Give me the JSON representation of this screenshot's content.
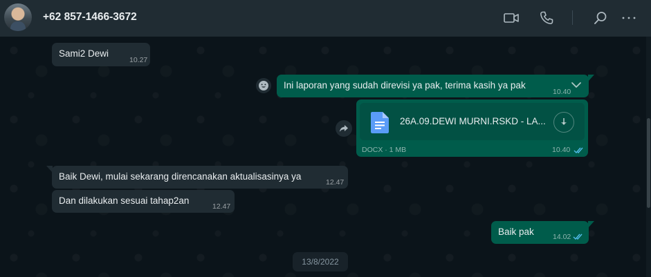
{
  "header": {
    "contact_name": "+62 857-1466-3672",
    "icons": [
      "video-call-icon",
      "voice-call-icon",
      "search-icon",
      "menu-icon"
    ]
  },
  "messages": [
    {
      "direction": "incoming",
      "text": "Sami2 Dewi",
      "time": "10.27"
    },
    {
      "direction": "outgoing",
      "text": "Ini laporan yang sudah direvisi ya pak, terima kasih ya pak",
      "time": "10.40"
    },
    {
      "direction": "outgoing",
      "type": "document",
      "filename": "26A.09.DEWI MURNI.RSKD - LA...",
      "file_type": "DOCX",
      "file_size": "1 MB",
      "meta": "DOCX · 1 MB",
      "time": "10.40",
      "status": "read"
    },
    {
      "direction": "incoming",
      "text": "Baik Dewi, mulai sekarang direncanakan aktualisasinya ya",
      "time": "12.47"
    },
    {
      "direction": "incoming",
      "text": "Dan dilakukan sesuai tahap2an",
      "time": "12.47"
    },
    {
      "direction": "outgoing",
      "text": "Baik pak",
      "time": "14.02",
      "status": "read"
    }
  ],
  "date_separator": "13/8/2022",
  "colors": {
    "header_bg": "#202c33",
    "chat_bg": "#0b141a",
    "incoming_bubble": "#202c33",
    "outgoing_bubble": "#005c4b",
    "read_tick": "#53bdeb",
    "doc_icon": "#5a9cf8"
  }
}
